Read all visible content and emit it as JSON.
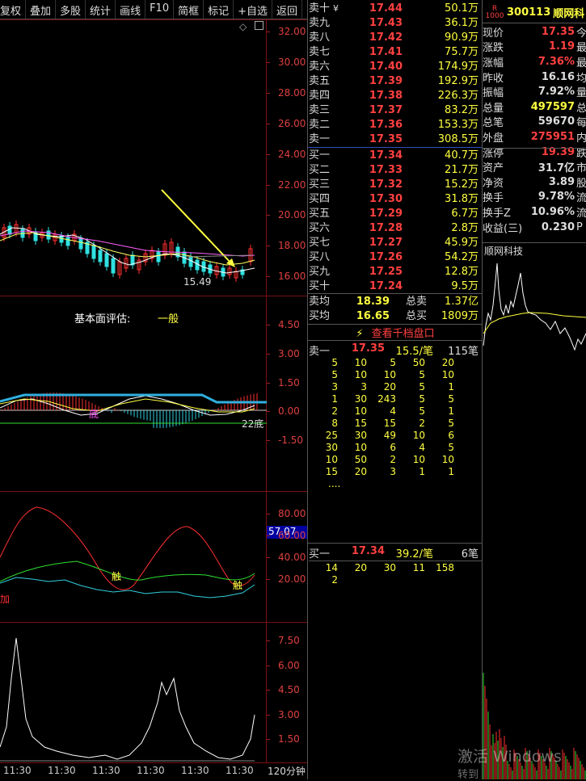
{
  "toolbar": [
    "复权",
    "叠加",
    "多股",
    "统计",
    "画线",
    "F10",
    "简框",
    "标记",
    "+自选",
    "返回"
  ],
  "price_axis": [
    "32.00",
    "30.00",
    "28.00",
    "26.00",
    "24.00",
    "22.00",
    "20.00",
    "18.00",
    "16.00"
  ],
  "kline": {
    "low_label": "15.49",
    "eval_label": "基本面评估:",
    "eval_value": "一般"
  },
  "macd_axis": [
    "4.50",
    "3.00",
    "1.50",
    "0.00",
    "-1.50"
  ],
  "macd_marks": {
    "label1": "底",
    "label2": "底",
    "label3": "底",
    "label4": "22底"
  },
  "kdj_axis": [
    "80.00",
    "60.00",
    "40.00",
    "20.00"
  ],
  "kdj_current": "57.07",
  "kdj_marks": {
    "chu1": "触",
    "chu2": "触",
    "left": "加"
  },
  "vol_axis": [
    "7.50",
    "6.00",
    "4.50",
    "3.00",
    "1.50"
  ],
  "time_labels": [
    "11:30",
    "11:30",
    "11:30",
    "11:30",
    "11:30",
    "11:30"
  ],
  "period": "120分钟",
  "asks": [
    {
      "label": "卖十",
      "arrow": "¥",
      "price": "17.44",
      "vol": "50.1万"
    },
    {
      "label": "卖九",
      "price": "17.43",
      "vol": "36.1万"
    },
    {
      "label": "卖八",
      "price": "17.42",
      "vol": "90.9万"
    },
    {
      "label": "卖七",
      "price": "17.41",
      "vol": "75.7万"
    },
    {
      "label": "卖六",
      "price": "17.40",
      "vol": "174.9万"
    },
    {
      "label": "卖五",
      "price": "17.39",
      "vol": "192.9万"
    },
    {
      "label": "卖四",
      "price": "17.38",
      "vol": "226.3万"
    },
    {
      "label": "卖三",
      "price": "17.37",
      "vol": "83.2万"
    },
    {
      "label": "卖二",
      "price": "17.36",
      "vol": "153.3万"
    },
    {
      "label": "卖一",
      "price": "17.35",
      "vol": "308.5万"
    }
  ],
  "bids": [
    {
      "label": "买一",
      "price": "17.34",
      "vol": "40.7万"
    },
    {
      "label": "买二",
      "price": "17.33",
      "vol": "21.7万"
    },
    {
      "label": "买三",
      "price": "17.32",
      "vol": "15.2万"
    },
    {
      "label": "买四",
      "price": "17.30",
      "vol": "31.8万"
    },
    {
      "label": "买五",
      "price": "17.29",
      "vol": "6.7万"
    },
    {
      "label": "买六",
      "price": "17.28",
      "vol": "2.8万"
    },
    {
      "label": "买七",
      "price": "17.27",
      "vol": "45.9万"
    },
    {
      "label": "买八",
      "price": "17.26",
      "vol": "54.2万"
    },
    {
      "label": "买九",
      "price": "17.25",
      "vol": "12.8万"
    },
    {
      "label": "买十",
      "price": "17.24",
      "vol": "9.5万"
    }
  ],
  "avg": {
    "sell_label": "卖均",
    "sell_price": "18.39",
    "total_sell_label": "总卖",
    "total_sell": "1.37亿",
    "buy_label": "买均",
    "buy_price": "16.65",
    "total_buy_label": "总买",
    "total_buy": "1809万"
  },
  "qiandang": "查看千档盘口",
  "sell1_queue": {
    "label": "卖一",
    "price": "17.35",
    "avg": "15.5/笔",
    "count": "115笔",
    "rows": [
      [
        "5",
        "10",
        "5",
        "50",
        "20"
      ],
      [
        "5",
        "10",
        "10",
        "5",
        "10"
      ],
      [
        "3",
        "3",
        "20",
        "5",
        "1"
      ],
      [
        "1",
        "30",
        "243",
        "5",
        "5"
      ],
      [
        "2",
        "10",
        "4",
        "5",
        "1"
      ],
      [
        "8",
        "15",
        "15",
        "2",
        "5"
      ],
      [
        "25",
        "30",
        "49",
        "10",
        "6"
      ],
      [
        "30",
        "10",
        "6",
        "4",
        "5"
      ],
      [
        "10",
        "50",
        "2",
        "10",
        "10"
      ],
      [
        "15",
        "20",
        "3",
        "1",
        "1"
      ]
    ],
    "more": "...."
  },
  "buy1_queue": {
    "label": "买一",
    "price": "17.34",
    "avg": "39.2/笔",
    "count": "6笔",
    "rows": [
      [
        "14",
        "20",
        "30",
        "11",
        "158"
      ],
      [
        "2",
        "",
        "",
        "",
        ""
      ]
    ]
  },
  "stock": {
    "code": "300113",
    "name": "顺网科",
    "r_label": "R",
    "r_sub": "1000"
  },
  "quote": [
    {
      "k": "现价",
      "v": "17.35",
      "c": "#ff4040",
      "x": "今"
    },
    {
      "k": "涨跌",
      "v": "1.19",
      "c": "#ff4040",
      "x": "最"
    },
    {
      "k": "涨幅",
      "v": "7.36%",
      "c": "#ff4040",
      "x": "最"
    },
    {
      "k": "昨收",
      "v": "16.16",
      "c": "#ddd",
      "x": "均"
    },
    {
      "k": "振幅",
      "v": "7.92%",
      "c": "#ddd",
      "x": "量"
    },
    {
      "k": "总量",
      "v": "497597",
      "c": "#ffff40",
      "x": "总"
    },
    {
      "k": "总笔",
      "v": "59670",
      "c": "#ddd",
      "x": "每"
    },
    {
      "k": "外盘",
      "v": "275951",
      "c": "#ff4040",
      "x": "内"
    },
    {
      "k": "涨停",
      "v": "19.39",
      "c": "#ff4040",
      "x": "跌"
    },
    {
      "k": "资产",
      "v": "31.7亿",
      "c": "#ddd",
      "x": "市"
    },
    {
      "k": "净资",
      "v": "3.89",
      "c": "#ddd",
      "x": "股"
    },
    {
      "k": "换手",
      "v": "9.78%",
      "c": "#ddd",
      "x": "流"
    },
    {
      "k": "换手Z",
      "v": "10.96%",
      "c": "#ddd",
      "x": "流"
    },
    {
      "k": "收益(三)",
      "v": "0.230",
      "c": "#ddd",
      "x": "P"
    }
  ],
  "mini_title": "顺网科技",
  "watermark1": "激活 Windows",
  "watermark2": "转到"
}
